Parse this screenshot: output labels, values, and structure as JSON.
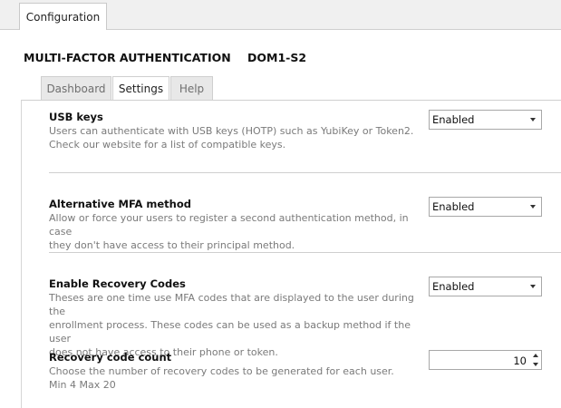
{
  "window": {
    "top_tab": "Configuration"
  },
  "header": {
    "title": "MULTI-FACTOR AUTHENTICATION",
    "server": "DOM1-S2"
  },
  "tabs": [
    {
      "label": "Dashboard",
      "active": false
    },
    {
      "label": "Settings",
      "active": true
    },
    {
      "label": "Help",
      "active": false
    }
  ],
  "settings": [
    {
      "title": "USB keys",
      "description_lines": [
        "Users can authenticate with USB keys (HOTP) such as YubiKey or Token2.",
        "Check our website for a list of compatible keys."
      ],
      "value": "Enabled"
    },
    {
      "title": "Alternative MFA method",
      "description_lines": [
        "Allow or force your users to register a second authentication method, in case",
        "they don't have access to their principal method."
      ],
      "value": "Enabled"
    },
    {
      "title": "Enable Recovery Codes",
      "description_lines": [
        "Theses are one time use MFA codes that are displayed to the user during the",
        "enrollment process. These codes can be used as a backup method if the user",
        "does not have access to their phone or token."
      ],
      "value": "Enabled"
    },
    {
      "title": "Recovery code count",
      "description_lines": [
        "Choose the number of recovery codes to be generated for each user.",
        "Min 4 Max 20"
      ],
      "value": "10"
    }
  ],
  "colors": {
    "panel_bg": "#ffffff",
    "chrome_bg": "#f0f0f0",
    "border": "#cfcfcf",
    "muted_text": "#7a7a7a"
  }
}
